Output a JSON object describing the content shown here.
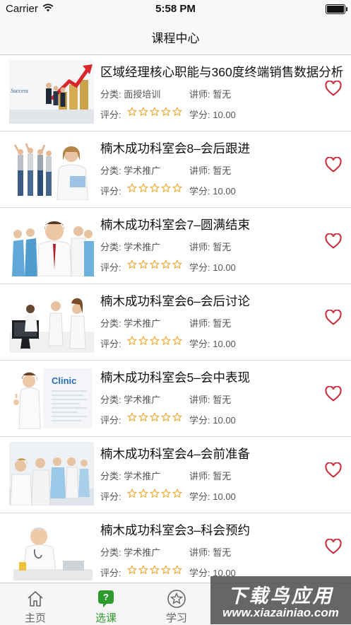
{
  "status_bar": {
    "carrier": "Carrier",
    "time": "5:58 PM"
  },
  "nav": {
    "title": "课程中心"
  },
  "labels": {
    "category": "分类:",
    "teacher": "讲师:",
    "rating": "评分:",
    "credit": "学分:"
  },
  "colors": {
    "star": "#f0a020",
    "heart": "#d0283a",
    "tab_active": "#2f9b2f"
  },
  "courses": [
    {
      "title": "区域经理核心职能与360度终端销售数据分析",
      "category": "面授培训",
      "teacher": "暂无",
      "credit": "10.00",
      "rating": 0,
      "thumb": "success-chart-businessmen"
    },
    {
      "title": "楠木成功科室会8–会后跟进",
      "category": "学术推广",
      "teacher": "暂无",
      "credit": "10.00",
      "rating": 0,
      "thumb": "cheering-people-doctor"
    },
    {
      "title": "楠木成功科室会7–圆满结束",
      "category": "学术推广",
      "teacher": "暂无",
      "credit": "10.00",
      "rating": 0,
      "thumb": "medical-team-group"
    },
    {
      "title": "楠木成功科室会6–会后讨论",
      "category": "学术推广",
      "teacher": "暂无",
      "credit": "10.00",
      "rating": 0,
      "thumb": "doctors-at-computer"
    },
    {
      "title": "楠木成功科室会5–会中表现",
      "category": "学术推广",
      "teacher": "暂无",
      "credit": "10.00",
      "rating": 0,
      "thumb": "clinic-doctor-thumbs-up"
    },
    {
      "title": "楠木成功科室会4–会前准备",
      "category": "学术推广",
      "teacher": "暂无",
      "credit": "10.00",
      "rating": 0,
      "thumb": "doctors-row-meeting"
    },
    {
      "title": "楠木成功科室会3–科会预约",
      "category": "学术推广",
      "teacher": "暂无",
      "credit": "10.00",
      "rating": 0,
      "thumb": "senior-doctor-desk"
    }
  ],
  "thumb_text": {
    "success": "Success",
    "clinic": "Clinic"
  },
  "tabs": [
    {
      "label": "主页",
      "icon": "home-icon",
      "active": false
    },
    {
      "label": "选课",
      "icon": "question-bubble-icon",
      "active": true,
      "icon_text": "?"
    },
    {
      "label": "学习",
      "icon": "star-circle-icon",
      "active": false
    }
  ],
  "watermark": {
    "text": "下载鸟应用",
    "url": "www.xiazainiao.com"
  }
}
